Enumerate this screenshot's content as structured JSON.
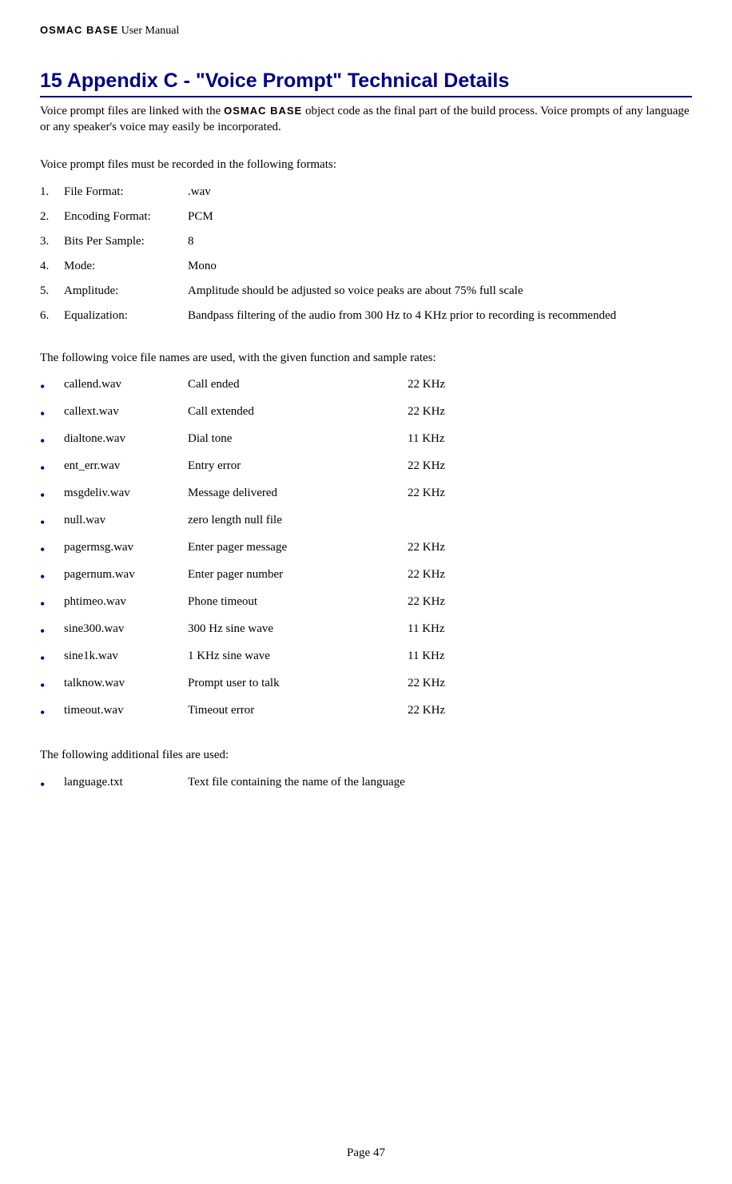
{
  "header": {
    "brand": "OSMAC BASE",
    "manual": " User Manual"
  },
  "title": "15 Appendix C - \"Voice Prompt\" Technical Details",
  "intro_part1": "Voice prompt files are linked with the ",
  "intro_brand": "OSMAC BASE",
  "intro_part2": " object code as the final part of the build process.  Voice prompts of any language or any speaker's voice may easily be incorporated.",
  "formats_intro": "Voice prompt files must be recorded in the following formats:",
  "formats": [
    {
      "num": "1.",
      "label": "File Format:",
      "val": ".wav"
    },
    {
      "num": "2.",
      "label": "Encoding Format:",
      "val": "PCM"
    },
    {
      "num": "3.",
      "label": "Bits Per Sample:",
      "val": "8"
    },
    {
      "num": "4.",
      "label": "Mode:",
      "val": "Mono"
    },
    {
      "num": "5.",
      "label": "Amplitude:",
      "val": "Amplitude should be adjusted so voice peaks are about 75% full scale"
    },
    {
      "num": "6.",
      "label": "Equalization:",
      "val": "Bandpass filtering of the audio from 300 Hz to 4 KHz prior to recording is recommended"
    }
  ],
  "files_intro": "The following voice file names are used, with the given function and sample rates:",
  "files": [
    {
      "name": "callend.wav",
      "func": "Call ended",
      "rate": "22 KHz"
    },
    {
      "name": "callext.wav",
      "func": "Call extended",
      "rate": "22 KHz"
    },
    {
      "name": "dialtone.wav",
      "func": "Dial tone",
      "rate": "11 KHz"
    },
    {
      "name": "ent_err.wav",
      "func": "Entry error",
      "rate": "22 KHz"
    },
    {
      "name": "msgdeliv.wav",
      "func": "Message delivered",
      "rate": "22 KHz"
    },
    {
      "name": "null.wav",
      "func": "zero length null file",
      "rate": ""
    },
    {
      "name": "pagermsg.wav",
      "func": "Enter pager message",
      "rate": "22 KHz"
    },
    {
      "name": "pagernum.wav",
      "func": "Enter pager number",
      "rate": "22 KHz"
    },
    {
      "name": "phtimeo.wav",
      "func": "Phone timeout",
      "rate": "22 KHz"
    },
    {
      "name": "sine300.wav",
      "func": "300 Hz sine wave",
      "rate": "11 KHz"
    },
    {
      "name": "sine1k.wav",
      "func": "1 KHz sine wave",
      "rate": "11 KHz"
    },
    {
      "name": "talknow.wav",
      "func": "Prompt user to talk",
      "rate": "22 KHz"
    },
    {
      "name": "timeout.wav",
      "func": "Timeout error",
      "rate": "22 KHz"
    }
  ],
  "additional_intro": "The following additional files are used:",
  "additional": [
    {
      "name": "language.txt",
      "func": "Text file containing the name of the language",
      "rate": ""
    }
  ],
  "footer": "Page 47"
}
